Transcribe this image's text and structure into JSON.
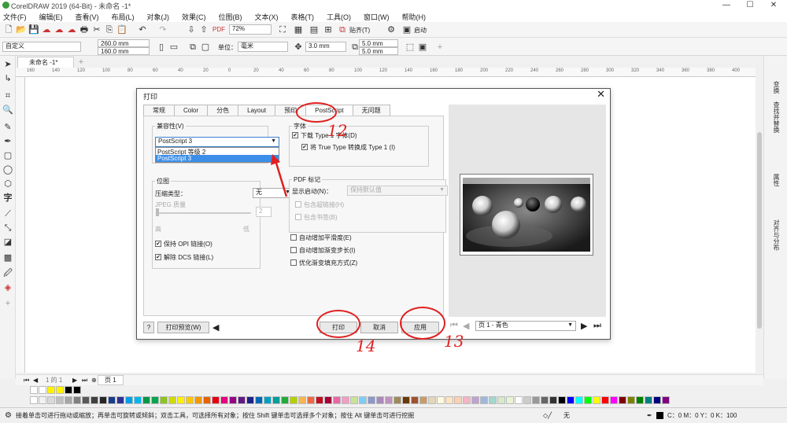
{
  "window": {
    "title": "CorelDRAW 2019 (64-Bit) - 未命名 -1*",
    "min": "—",
    "max": "☐",
    "close": "✕"
  },
  "menu": [
    "文件(F)",
    "编辑(E)",
    "查看(V)",
    "布局(L)",
    "对象(J)",
    "效果(C)",
    "位图(B)",
    "文本(X)",
    "表格(T)",
    "工具(O)",
    "窗口(W)",
    "帮助(H)"
  ],
  "toolbar": {
    "zoom": "72%",
    "snap_label": "贴齐(T)",
    "launch_label": "启动"
  },
  "propbar": {
    "preset": "自定义",
    "width": "260.0 mm",
    "height": "160.0 mm",
    "units_label": "单位：",
    "units": "毫米",
    "nudge": "3.0 mm",
    "dup_x": "5.0 mm",
    "dup_y": "5.0 mm"
  },
  "document_tab": "未命名 -1*",
  "ruler_marks": [
    "160",
    "140",
    "120",
    "100",
    "80",
    "60",
    "40",
    "20",
    "0",
    "20",
    "40",
    "60",
    "80",
    "100",
    "120",
    "140",
    "160",
    "180",
    "200",
    "220",
    "240",
    "260",
    "280",
    "300",
    "320",
    "340",
    "360",
    "380",
    "400"
  ],
  "right_dock": [
    "变换",
    "查找并替换",
    "属性",
    "对齐与分布"
  ],
  "page_tab": {
    "current": "1 的 1",
    "page": "页 1"
  },
  "status": {
    "hint": "接着单击可进行拖动或缩放；再单击可旋转或倾斜；双击工具，可选择所有对象；按住 Shift 键单击可选择多个对象；按住 Alt 键单击可进行挖掘",
    "fill": "无",
    "color": "C：0 M：0 Y：0 K：100"
  },
  "palette_top": [
    "#ffffff",
    "#ffffff",
    "#fff200",
    "#fff200",
    "#000000",
    "#000000"
  ],
  "palette": [
    "#ffffff",
    "#f2f2f2",
    "#d9d9d9",
    "#bfbfbf",
    "#a6a6a6",
    "#808080",
    "#595959",
    "#404040",
    "#262626",
    "#1a3c8c",
    "#2e3192",
    "#00a0e9",
    "#00b7ee",
    "#009944",
    "#00a650",
    "#8fc31f",
    "#cfdb00",
    "#fff100",
    "#fcc800",
    "#f39800",
    "#eb6100",
    "#e60012",
    "#e4007f",
    "#920783",
    "#601986",
    "#1d2088",
    "#0068b7",
    "#00a0c1",
    "#009e96",
    "#22ac38",
    "#b5d100",
    "#f8b551",
    "#ec6941",
    "#c30d23",
    "#a40035",
    "#ea68a2",
    "#f19ec2",
    "#cce198",
    "#7ecef4",
    "#8c97cb",
    "#aa89bd",
    "#c490bf",
    "#9e8a5d",
    "#6a3906",
    "#a0522d",
    "#c69c6d",
    "#e6d5b8",
    "#fffbd9",
    "#fde4c2",
    "#fdd0b1",
    "#f4b4c4",
    "#c0a3cd",
    "#9eb8dc",
    "#a3d6cc",
    "#d6e9ca",
    "#eaf4d3",
    "#ffffff",
    "#cccccc",
    "#999999",
    "#666666",
    "#333333",
    "#000000",
    "#0000ff",
    "#00ffff",
    "#00ff00",
    "#ffff00",
    "#ff0000",
    "#ff00ff",
    "#800000",
    "#808000",
    "#008000",
    "#008080",
    "#000080",
    "#800080"
  ],
  "dialog": {
    "title": "打印",
    "close": "✕",
    "tabs": [
      "常规",
      "Color",
      "分色",
      "Layout",
      "预印",
      "PostScript",
      "无问题"
    ],
    "compat_label": "兼容性(V)",
    "compat_value": "PostScript 3",
    "compat_options": [
      "PostScript 等级 2",
      "PostScript 3"
    ],
    "fonts_label": "字体",
    "download_type1": "下载 Type 1 字体(D)",
    "convert_truetype": "将 True Type 转换成 Type 1 (I)",
    "bitmap_label": "位图",
    "compress_label": "压缩类型：",
    "compress_value": "无",
    "jpeg_quality": "JPEG 质量",
    "quality_value": "2",
    "high": "高",
    "low": "低",
    "opi": "保持 OPI 链接(O)",
    "dcs": "解除 DCS 链接(L)",
    "pdf_label": "PDF 标记",
    "show_start_label": "显示启动(N)：",
    "show_start_value": "保持默认值",
    "include_hyperlinks": "包含超链接(H)",
    "include_bookmarks": "包含书签(B)",
    "auto_flatness": "自动增加平滑度(E)",
    "auto_fountain": "自动增加渐变步长(I)",
    "optimize_fountain": "优化渐变填充方式(Z)",
    "help": "?",
    "print_preview": "打印预览(W)",
    "print": "打印",
    "cancel": "取消",
    "apply": "应用",
    "page_select": "页 1 - 青色"
  },
  "annotations": {
    "n12": "12",
    "n14": "14",
    "n13": "13"
  }
}
